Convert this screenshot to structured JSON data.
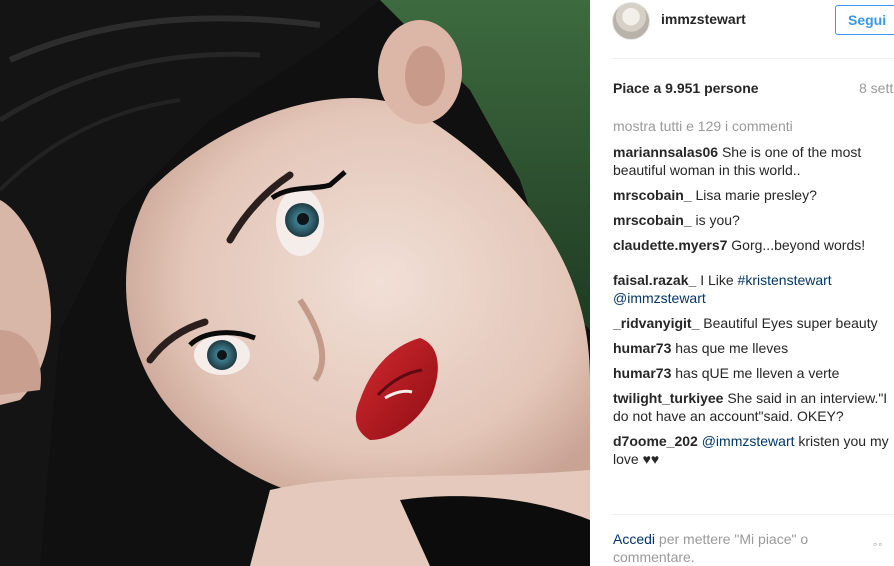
{
  "photo": {
    "alt": "",
    "colors": {
      "background": "#0f0f0f",
      "skin": "#e9d2c6",
      "lips": "#b8141c",
      "eyes": "#3e7c8e",
      "hair": "#141414"
    }
  },
  "header": {
    "username": "immzstewart",
    "follow_label": "Segui"
  },
  "stats": {
    "likes": "Piace a 9.951 persone",
    "date": "8 sett"
  },
  "comments_section": {
    "show_all": "mostra tutti e 129 i commenti",
    "items": [
      {
        "user": "mariannsalas06",
        "text": "She is one of the most beautiful woman in this world.."
      },
      {
        "user": "mrscobain_",
        "text": "Lisa marie presley?"
      },
      {
        "user": "mrscobain_",
        "text": "is you?"
      },
      {
        "user": "claudette.myers7",
        "text": "Gorg...beyond words!"
      },
      {
        "user": "faisal.razak_",
        "text": "I Like",
        "tag": "#kristenstewart",
        "mention": "@immzstewart"
      },
      {
        "user": "_ridvanyigit_",
        "text": "Beautiful Eyes super beauty"
      },
      {
        "user": "humar73",
        "text": "has que me lleves"
      },
      {
        "user": "humar73",
        "text": "has qUE me lleven a verte"
      },
      {
        "user": "twilight_turkiyee",
        "text": "She said in an interview.\"I do not have an account\"said. OKEY?"
      },
      {
        "user": "d7oome_202",
        "mention": "@immzstewart",
        "text": "kristen you my love ♥♥"
      }
    ]
  },
  "footer": {
    "login_label": "Accedi",
    "rest": "per mettere \"Mi piace\" o commentare.",
    "more_label": "◦◦"
  },
  "colors": {
    "accent": "#3897f0",
    "link": "#003569",
    "muted": "#999999",
    "text": "#262626"
  }
}
